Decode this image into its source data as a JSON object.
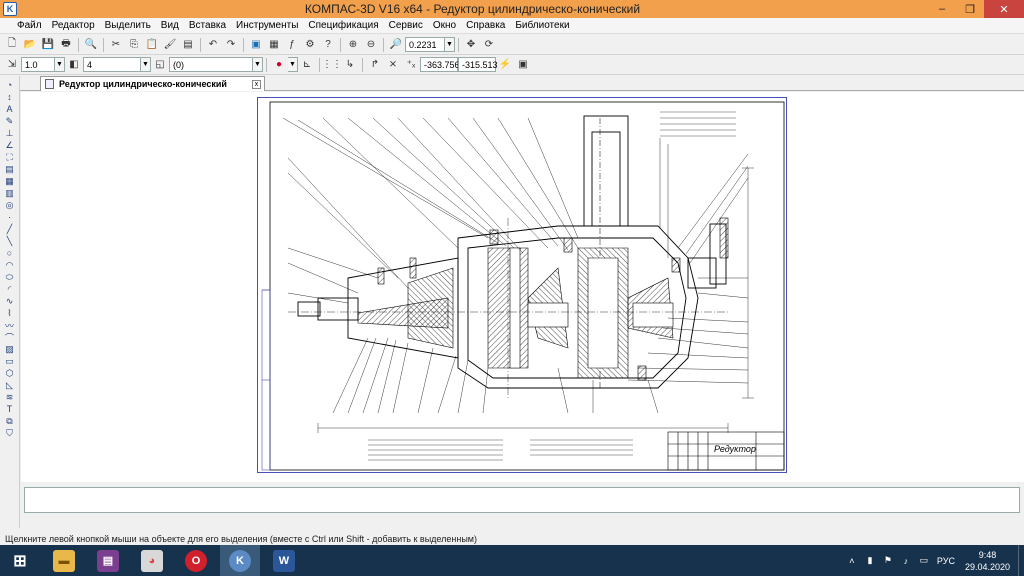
{
  "window": {
    "title": "КОМПАС-3D V16  x64 - Редуктор цилиндрическо-конический",
    "minimize": "–",
    "restore": "❐",
    "close": "✕"
  },
  "menu": [
    "Файл",
    "Редактор",
    "Выделить",
    "Вид",
    "Вставка",
    "Инструменты",
    "Спецификация",
    "Сервис",
    "Окно",
    "Справка",
    "Библиотеки"
  ],
  "toolbar1": {
    "zoom_value": "0.2231"
  },
  "toolbar2": {
    "line_scale": "1.0",
    "layer": "4",
    "view": "(0)",
    "coord_x": "-363.756",
    "coord_y": "-315.513"
  },
  "document_tab": {
    "label": "Редуктор цилиндрическо-конический",
    "close": "x"
  },
  "drawing": {
    "stamp_title": "Редуктор"
  },
  "statusbar": {
    "hint": "Щелкните левой кнопкой мыши на объекте для его выделения (вместе с Ctrl или Shift - добавить к выделенным)"
  },
  "taskbar": {
    "language": "РУС",
    "time": "9:48",
    "date": "29.04.2020"
  },
  "colors": {
    "titlebar": "#f3a04d",
    "close_button": "#c9433f",
    "sheet_frame": "#4650b6",
    "taskbar": "#17324d"
  }
}
